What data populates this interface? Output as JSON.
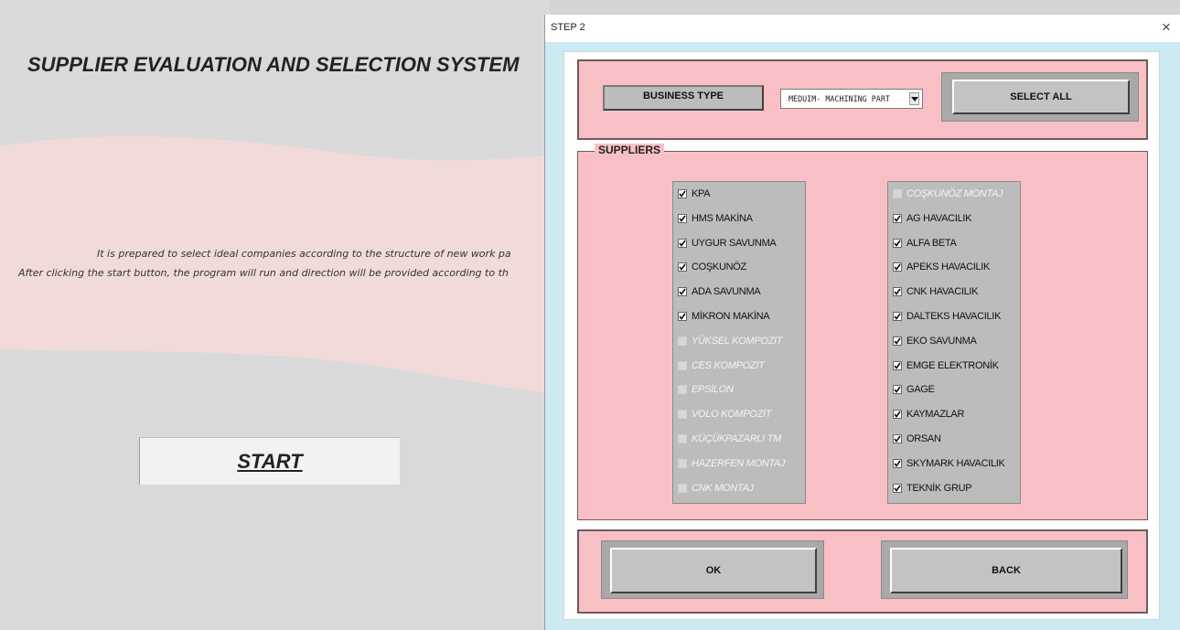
{
  "sheet": {
    "title": "SUPPLIER EVALUATION AND SELECTION SYSTEM",
    "description_line1": "It is prepared to select ideal companies according to the structure of new work pa",
    "description_line2": "After clicking the start button, the program will run and direction will be provided according to th",
    "start_label": "START"
  },
  "dialog": {
    "title": "STEP 2",
    "close_glyph": "×",
    "business_type_label": "BUSINESS TYPE",
    "business_type_value": "MEDUIM- MACHINING PART",
    "select_all_label": "SELECT ALL",
    "suppliers_label": "SUPPLIERS",
    "left_list": [
      {
        "name": "KPA",
        "checked": true,
        "enabled": true
      },
      {
        "name": "HMS MAKİNA",
        "checked": true,
        "enabled": true
      },
      {
        "name": "UYGUR SAVUNMA",
        "checked": true,
        "enabled": true
      },
      {
        "name": "COŞKUNÖZ",
        "checked": true,
        "enabled": true
      },
      {
        "name": "ADA SAVUNMA",
        "checked": true,
        "enabled": true
      },
      {
        "name": "MİKRON MAKİNA",
        "checked": true,
        "enabled": true
      },
      {
        "name": "YÜKSEL KOMPOZİT",
        "checked": false,
        "enabled": false
      },
      {
        "name": "CES KOMPOZİT",
        "checked": false,
        "enabled": false
      },
      {
        "name": "EPSİLON",
        "checked": false,
        "enabled": false
      },
      {
        "name": "VOLO KOMPOZİT",
        "checked": false,
        "enabled": false
      },
      {
        "name": "KÜÇÜKPAZARLI TM",
        "checked": false,
        "enabled": false
      },
      {
        "name": "HAZERFEN MONTAJ",
        "checked": false,
        "enabled": false
      },
      {
        "name": "CNK MONTAJ",
        "checked": false,
        "enabled": false
      }
    ],
    "right_list": [
      {
        "name": "COŞKUNÖZ MONTAJ",
        "checked": false,
        "enabled": false
      },
      {
        "name": "AG HAVACILIK",
        "checked": true,
        "enabled": true
      },
      {
        "name": "ALFA BETA",
        "checked": true,
        "enabled": true
      },
      {
        "name": "APEKS HAVACILIK",
        "checked": true,
        "enabled": true
      },
      {
        "name": "CNK HAVACILIK",
        "checked": true,
        "enabled": true
      },
      {
        "name": "DALTEKS HAVACILIK",
        "checked": true,
        "enabled": true
      },
      {
        "name": "EKO SAVUNMA",
        "checked": true,
        "enabled": true
      },
      {
        "name": "EMGE ELEKTRONİK",
        "checked": true,
        "enabled": true
      },
      {
        "name": "GAGE",
        "checked": true,
        "enabled": true
      },
      {
        "name": "KAYMAZLAR",
        "checked": true,
        "enabled": true
      },
      {
        "name": "ORSAN",
        "checked": true,
        "enabled": true
      },
      {
        "name": "SKYMARK HAVACILIK",
        "checked": true,
        "enabled": true
      },
      {
        "name": "TEKNİK GRUP",
        "checked": true,
        "enabled": true
      }
    ],
    "ok_label": "OK",
    "back_label": "BACK"
  },
  "colors": {
    "panel_pink": "#f8c0c4",
    "dialog_border": "#cde9f1",
    "button_gray": "#c3c3c3"
  }
}
